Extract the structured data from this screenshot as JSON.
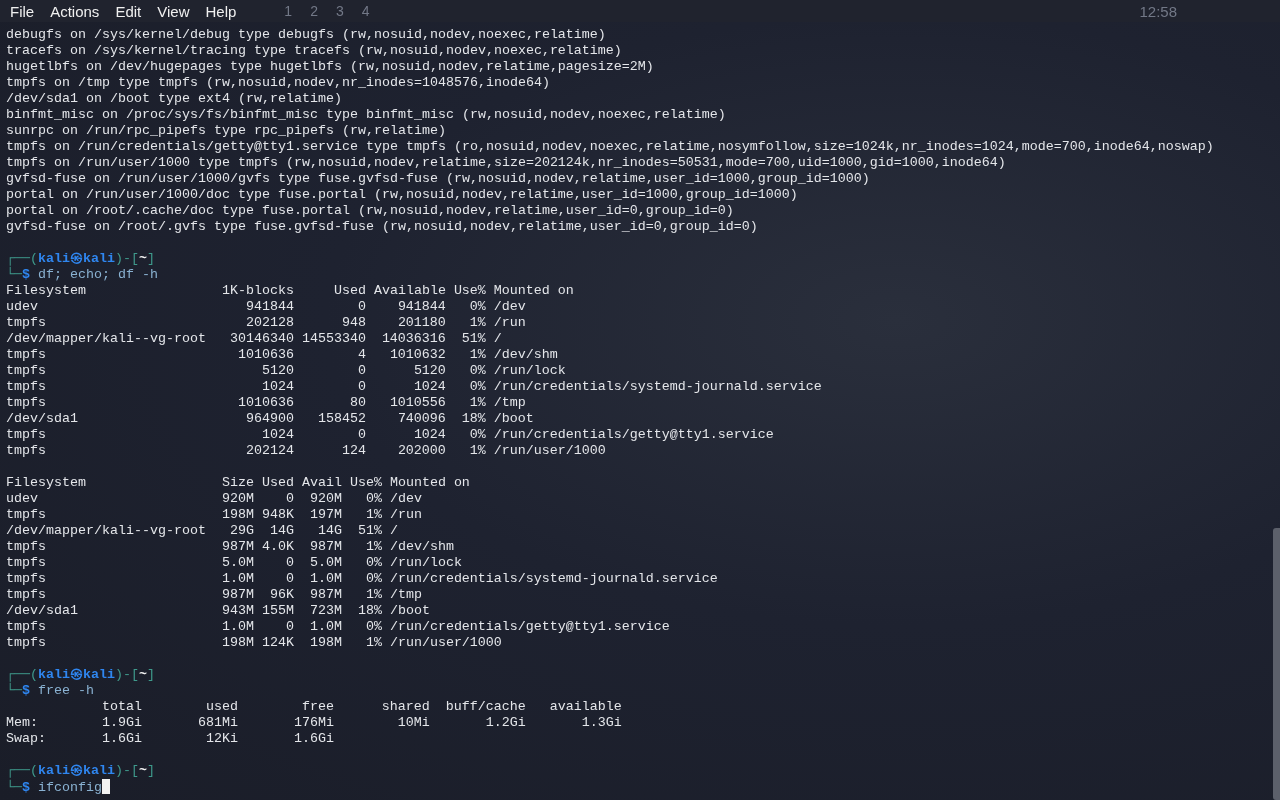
{
  "menu": [
    {
      "label": "File"
    },
    {
      "label": "Actions"
    },
    {
      "label": "Edit"
    },
    {
      "label": "View"
    },
    {
      "label": "Help"
    }
  ],
  "panel": {
    "workspaces": [
      "1",
      "2",
      "3",
      "4"
    ],
    "clock": "12:58"
  },
  "terminal": {
    "lines": [
      {
        "kind": "text",
        "text": "debugfs on /sys/kernel/debug type debugfs (rw,nosuid,nodev,noexec,relatime)"
      },
      {
        "kind": "text",
        "text": "tracefs on /sys/kernel/tracing type tracefs (rw,nosuid,nodev,noexec,relatime)"
      },
      {
        "kind": "text",
        "text": "hugetlbfs on /dev/hugepages type hugetlbfs (rw,nosuid,nodev,relatime,pagesize=2M)"
      },
      {
        "kind": "text",
        "text": "tmpfs on /tmp type tmpfs (rw,nosuid,nodev,nr_inodes=1048576,inode64)"
      },
      {
        "kind": "text",
        "text": "/dev/sda1 on /boot type ext4 (rw,relatime)"
      },
      {
        "kind": "text",
        "text": "binfmt_misc on /proc/sys/fs/binfmt_misc type binfmt_misc (rw,nosuid,nodev,noexec,relatime)"
      },
      {
        "kind": "text",
        "text": "sunrpc on /run/rpc_pipefs type rpc_pipefs (rw,relatime)"
      },
      {
        "kind": "text",
        "text": "tmpfs on /run/credentials/getty@tty1.service type tmpfs (ro,nosuid,nodev,noexec,relatime,nosymfollow,size=1024k,nr_inodes=1024,mode=700,inode64,noswap)"
      },
      {
        "kind": "text",
        "text": "tmpfs on /run/user/1000 type tmpfs (rw,nosuid,nodev,relatime,size=202124k,nr_inodes=50531,mode=700,uid=1000,gid=1000,inode64)"
      },
      {
        "kind": "text",
        "text": "gvfsd-fuse on /run/user/1000/gvfs type fuse.gvfsd-fuse (rw,nosuid,nodev,relatime,user_id=1000,group_id=1000)"
      },
      {
        "kind": "text",
        "text": "portal on /run/user/1000/doc type fuse.portal (rw,nosuid,nodev,relatime,user_id=1000,group_id=1000)"
      },
      {
        "kind": "text",
        "text": "portal on /root/.cache/doc type fuse.portal (rw,nosuid,nodev,relatime,user_id=0,group_id=0)"
      },
      {
        "kind": "text",
        "text": "gvfsd-fuse on /root/.gvfs type fuse.gvfsd-fuse (rw,nosuid,nodev,relatime,user_id=0,group_id=0)"
      },
      {
        "kind": "blank"
      },
      {
        "kind": "prompt",
        "open": "┌──(",
        "user": "kali",
        "at": "㉿",
        "host": "kali",
        "middle": ")-[",
        "dir": "~",
        "close": "]"
      },
      {
        "kind": "command",
        "corner": "└─",
        "sign": "$",
        "text": "df; echo; df -h",
        "cursor": false
      },
      {
        "kind": "table",
        "columns": [
          "Filesystem",
          "1K-blocks",
          "Used",
          "Available",
          "Use%",
          "Mounted on"
        ],
        "rows": [
          [
            "udev",
            "941844",
            "0",
            "941844",
            "0%",
            "/dev"
          ],
          [
            "tmpfs",
            "202128",
            "948",
            "201180",
            "1%",
            "/run"
          ],
          [
            "/dev/mapper/kali--vg-root",
            "30146340",
            "14553340",
            "14036316",
            "51%",
            "/"
          ],
          [
            "tmpfs",
            "1010636",
            "4",
            "1010632",
            "1%",
            "/dev/shm"
          ],
          [
            "tmpfs",
            "5120",
            "0",
            "5120",
            "0%",
            "/run/lock"
          ],
          [
            "tmpfs",
            "1024",
            "0",
            "1024",
            "0%",
            "/run/credentials/systemd-journald.service"
          ],
          [
            "tmpfs",
            "1010636",
            "80",
            "1010556",
            "1%",
            "/tmp"
          ],
          [
            "/dev/sda1",
            "964900",
            "158452",
            "740096",
            "18%",
            "/boot"
          ],
          [
            "tmpfs",
            "1024",
            "0",
            "1024",
            "0%",
            "/run/credentials/getty@tty1.service"
          ],
          [
            "tmpfs",
            "202124",
            "124",
            "202000",
            "1%",
            "/run/user/1000"
          ]
        ]
      },
      {
        "kind": "blank"
      },
      {
        "kind": "table",
        "columns": [
          "Filesystem",
          "Size",
          "Used",
          "Avail",
          "Use%",
          "Mounted on"
        ],
        "rows": [
          [
            "udev",
            "920M",
            "0",
            "920M",
            "0%",
            "/dev"
          ],
          [
            "tmpfs",
            "198M",
            "948K",
            "197M",
            "1%",
            "/run"
          ],
          [
            "/dev/mapper/kali--vg-root",
            "29G",
            "14G",
            "14G",
            "51%",
            "/"
          ],
          [
            "tmpfs",
            "987M",
            "4.0K",
            "987M",
            "1%",
            "/dev/shm"
          ],
          [
            "tmpfs",
            "5.0M",
            "0",
            "5.0M",
            "0%",
            "/run/lock"
          ],
          [
            "tmpfs",
            "1.0M",
            "0",
            "1.0M",
            "0%",
            "/run/credentials/systemd-journald.service"
          ],
          [
            "tmpfs",
            "987M",
            "96K",
            "987M",
            "1%",
            "/tmp"
          ],
          [
            "/dev/sda1",
            "943M",
            "155M",
            "723M",
            "18%",
            "/boot"
          ],
          [
            "tmpfs",
            "1.0M",
            "0",
            "1.0M",
            "0%",
            "/run/credentials/getty@tty1.service"
          ],
          [
            "tmpfs",
            "198M",
            "124K",
            "198M",
            "1%",
            "/run/user/1000"
          ]
        ]
      },
      {
        "kind": "blank"
      },
      {
        "kind": "prompt",
        "open": "┌──(",
        "user": "kali",
        "at": "㉿",
        "host": "kali",
        "middle": ")-[",
        "dir": "~",
        "close": "]"
      },
      {
        "kind": "command",
        "corner": "└─",
        "sign": "$",
        "text": "free -h",
        "cursor": false
      },
      {
        "kind": "stats",
        "columns": [
          "",
          "total",
          "used",
          "free",
          "shared",
          "buff/cache",
          "available"
        ],
        "rows": [
          [
            "Mem:",
            "1.9Gi",
            "681Mi",
            "176Mi",
            "10Mi",
            "1.2Gi",
            "1.3Gi"
          ],
          [
            "Swap:",
            "1.6Gi",
            "12Ki",
            "1.6Gi"
          ]
        ]
      },
      {
        "kind": "blank"
      },
      {
        "kind": "prompt",
        "open": "┌──(",
        "user": "kali",
        "at": "㉿",
        "host": "kali",
        "middle": ")-[",
        "dir": "~",
        "close": "]"
      },
      {
        "kind": "command",
        "corner": "└─",
        "sign": "$",
        "text": "ifconfig",
        "cursor": true
      }
    ]
  }
}
